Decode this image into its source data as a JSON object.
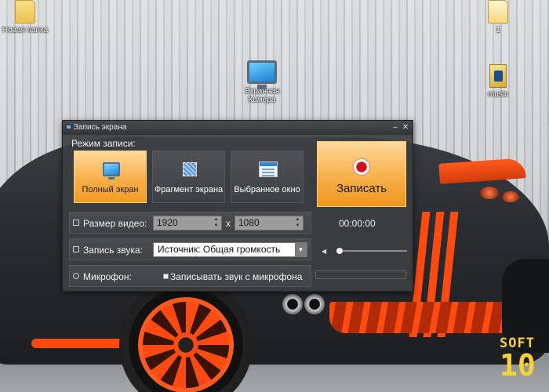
{
  "desktop": {
    "icons": [
      {
        "label": "Новая папка"
      },
      {
        "label": "1"
      },
      {
        "label": "Экранная Камера"
      },
      {
        "label": "music"
      }
    ],
    "watermark": {
      "top": "SOFT",
      "bottom": "10"
    }
  },
  "window": {
    "title": "Запись экрана",
    "minimize_glyph": "–",
    "close_glyph": "✕"
  },
  "mode": {
    "label": "Режим записи:",
    "options": [
      {
        "label": "Полный экран",
        "icon": "monitor-icon",
        "active": true
      },
      {
        "label": "Фрагмент экрана",
        "icon": "fragment-icon",
        "active": false
      },
      {
        "label": "Выбранное окно",
        "icon": "window-icon",
        "active": false
      }
    ]
  },
  "record": {
    "label": "Записать"
  },
  "video_size": {
    "label": "Размер видео:",
    "width": "1920",
    "separator": "x",
    "height": "1080"
  },
  "timer": "00:00:00",
  "audio": {
    "label": "Запись звука:",
    "source": "Источник: Общая громкость",
    "volume_level": 0.0
  },
  "mic": {
    "label": "Микрофон:",
    "checkbox_label": "Записывать звук с микрофона",
    "checked": true
  },
  "colors": {
    "accent": "#f7b04b",
    "window_bg": "#3c3e40",
    "watermark": "#f5d23a",
    "car_accent": "#ff4a12"
  }
}
